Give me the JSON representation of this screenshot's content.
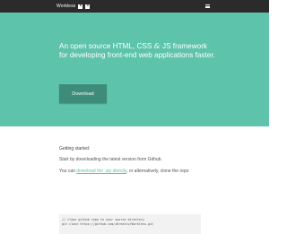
{
  "header": {
    "brand": "Workless",
    "badges": [
      "h",
      "5"
    ],
    "menu_icon": "hamburger-menu-icon"
  },
  "hero": {
    "title_pre": "An open source HTML, CSS ",
    "title_amp": "&",
    "title_post": " JS framework for developing front-end web applications faster.",
    "download_label": "Download"
  },
  "content": {
    "getting_started": "Getting started:",
    "text1": "Start by downloading the latest version from Github.",
    "text2_pre": "You can ",
    "text2_link": "download the .zip directly",
    "text2_post": ", or alternatively, clone the repo",
    "code": [
      "// clone github repo to your source directory",
      "git clone https://github.com/iKreativ/Workless.git"
    ]
  },
  "colors": {
    "hero_bg": "#5ec3ab",
    "button_bg": "#3c8c79",
    "topbar_bg": "#2b2b2b"
  }
}
